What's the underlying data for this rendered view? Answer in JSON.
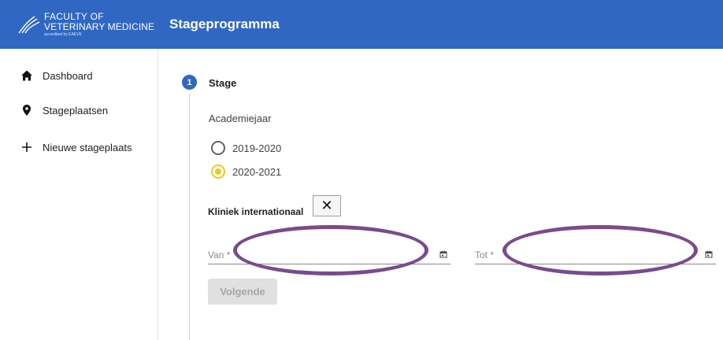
{
  "logo": {
    "line1": "FACULTY OF",
    "line2": "VETERINARY MEDICINE",
    "line3": "accredited by EAEVE"
  },
  "header": {
    "title": "Stageprogramma"
  },
  "sidebar": {
    "items": [
      {
        "label": "Dashboard",
        "icon": "home-icon"
      },
      {
        "label": "Stageplaatsen",
        "icon": "map-pin-icon"
      },
      {
        "label": "Nieuwe stageplaats",
        "icon": "plus-icon"
      }
    ]
  },
  "stepper": {
    "step_number": "1",
    "step_label": "Stage"
  },
  "form": {
    "academiejaar_label": "Academiejaar",
    "options": [
      {
        "label": "2019-2020",
        "checked": false
      },
      {
        "label": "2020-2021",
        "checked": true
      }
    ],
    "kliniek_label": "Kliniek internationaal",
    "close_symbol": "✕",
    "van_placeholder": "Van *",
    "tot_placeholder": "Tot *",
    "next_label": "Volgende"
  },
  "colors": {
    "primary": "#2f67c2",
    "radio_checked": "#f2c81e",
    "annotation": "#7a4b8c"
  }
}
